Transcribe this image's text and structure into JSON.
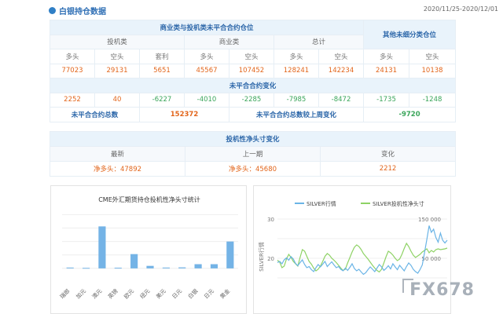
{
  "header": {
    "title": "白银持仓数据",
    "date_range": "2020/11/25-2020/12/01"
  },
  "positions": {
    "main_header": "商业类与投机类未平合合约仓位",
    "other_header": "其他未细分类仓位",
    "groups": [
      "投机类",
      "商业类",
      "总计"
    ],
    "col_labels": [
      "多头",
      "空头",
      "套利",
      "多头",
      "空头",
      "多头",
      "空头",
      "多头",
      "空头"
    ],
    "values": [
      "77023",
      "29131",
      "5651",
      "45567",
      "107452",
      "128241",
      "142234",
      "24131",
      "10138"
    ]
  },
  "changes": {
    "header": "未平合合约变化",
    "values": [
      "2252",
      "40",
      "-6227",
      "-4010",
      "-2285",
      "-7985",
      "-8472",
      "-1735",
      "-1248"
    ]
  },
  "totals": {
    "total_label": "未平合合约总数",
    "total_value": "152372",
    "weekly_label": "未平合合约总数较上周变化",
    "weekly_value": "-9720"
  },
  "spec_net": {
    "header": "投机性净头寸变化",
    "cols": [
      "最新",
      "上一期",
      "变化"
    ],
    "latest": "净多头：47892",
    "previous": "净多头：45680",
    "change": "2212"
  },
  "watermark": "FX678",
  "chart_data": [
    {
      "type": "bar",
      "title": "CME外汇期货持仓投机性净头寸统计",
      "categories": [
        "瑞郎",
        "加元",
        "澳元",
        "英镑",
        "欧元",
        "纽元",
        "美元",
        "日元",
        "白银",
        "日元",
        "黄金"
      ],
      "values": [
        0.5,
        0.3,
        25,
        0.4,
        8.5,
        1.5,
        0.5,
        0.6,
        2.5,
        2.5,
        16
      ],
      "ylim": [
        -8,
        35
      ],
      "color": "#74b3e6",
      "grid": true
    },
    {
      "type": "line",
      "series": [
        {
          "name": "SILVER行情",
          "color": "#6ab4e6"
        },
        {
          "name": "SILVER投机性净头寸",
          "color": "#8ed265"
        }
      ],
      "ylabel": "SILVER行情",
      "left_ticks": [
        "30",
        "20"
      ],
      "right_ticks": [
        "150 000",
        "50 000"
      ],
      "silver_price": [
        18.9,
        19.2,
        18.6,
        19.6,
        20.1,
        19.5,
        20.4,
        19.8,
        18.7,
        18.1,
        18.9,
        19.6,
        18.4,
        17.6,
        17.9,
        17.1,
        16.6,
        17.6,
        18.4,
        17.8,
        18.5,
        19.2,
        17.9,
        18.5,
        19.1,
        18.3,
        17.6,
        17.9,
        17.2,
        16.8,
        17.5,
        16.9,
        17.7,
        18.6,
        17.4,
        16.8,
        17.2,
        16.5,
        15.9,
        16.3,
        17.1,
        17.8,
        17.2,
        16.6,
        17.5,
        18.4,
        17.8,
        16.9,
        17.4,
        18.1,
        17.3,
        18.6,
        17.8,
        17.1,
        18.2,
        17.5,
        16.8,
        17.9,
        18.8,
        18.2,
        17.2,
        16.6,
        16.2,
        17.1,
        18.3,
        21.5,
        24.8,
        28.3,
        26.6,
        27.4,
        25.3,
        24.1,
        26.4,
        24.6,
        23.9,
        24.6
      ],
      "silver_net": [
        45000,
        40000,
        26000,
        30000,
        48000,
        60000,
        52000,
        42000,
        36000,
        30000,
        52000,
        72000,
        68000,
        55000,
        42000,
        35000,
        25000,
        18000,
        22000,
        30000,
        42000,
        55000,
        62000,
        58000,
        50000,
        45000,
        39000,
        32000,
        25000,
        19000,
        22000,
        38000,
        52000,
        66000,
        78000,
        84000,
        80000,
        72000,
        62000,
        55000,
        48000,
        40000,
        32000,
        25000,
        19000,
        15000,
        22000,
        38000,
        54000,
        68000,
        64000,
        58000,
        50000,
        44000,
        48000,
        60000,
        75000,
        88000,
        80000,
        68000,
        58000,
        52000,
        56000,
        60000,
        66000,
        70000,
        74000,
        64000,
        70000,
        66000,
        72000,
        74000,
        72000,
        73000,
        74000,
        76000
      ]
    }
  ]
}
